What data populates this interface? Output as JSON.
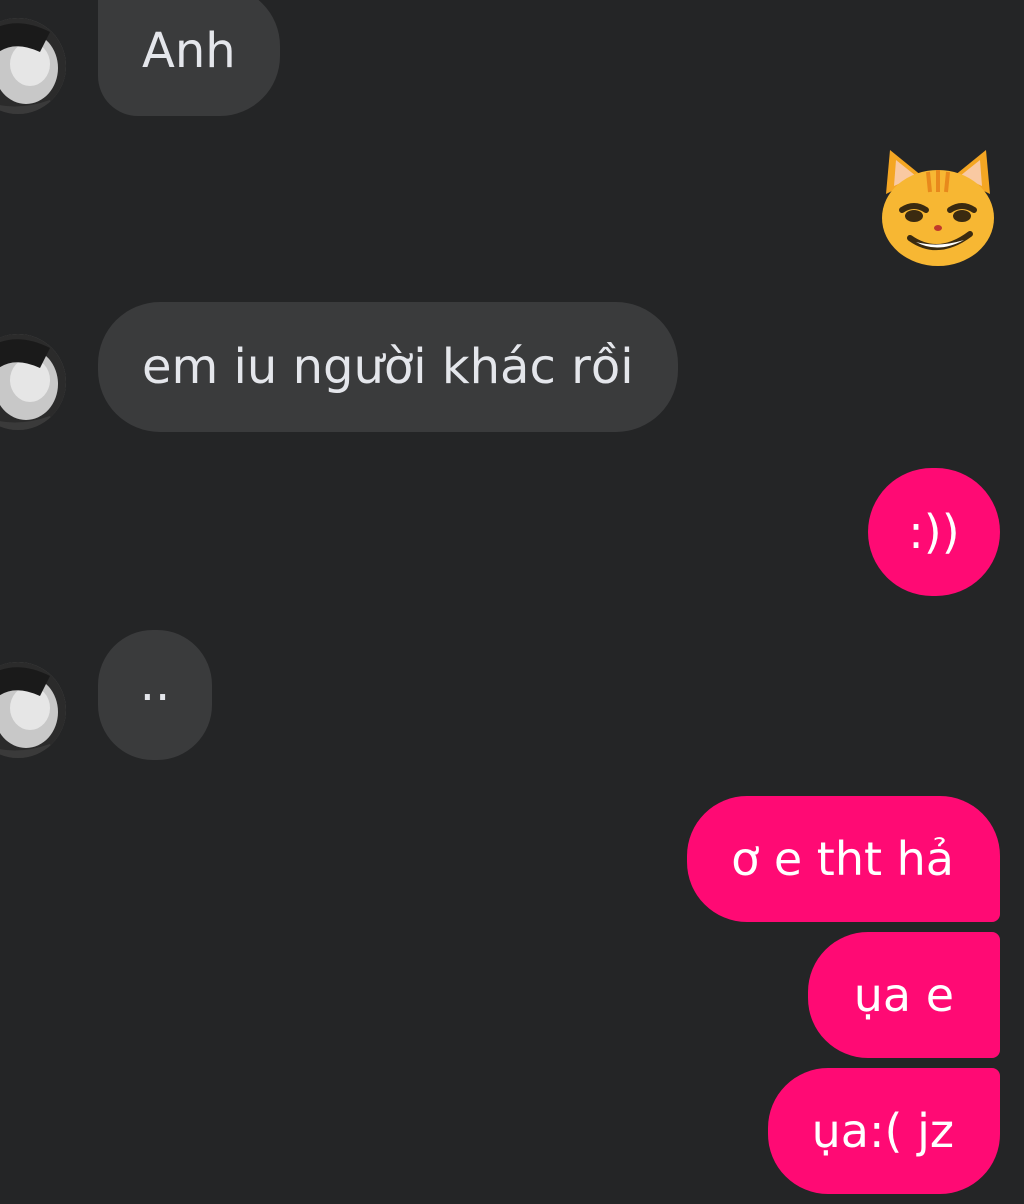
{
  "colors": {
    "background": "#242526",
    "incoming_bubble": "#3a3b3c",
    "incoming_text": "#e4e6eb",
    "outgoing_bubble": "#ff0a74",
    "outgoing_text": "#ffffff"
  },
  "messages": [
    {
      "sender": "other",
      "text": "Anh"
    },
    {
      "sender": "me",
      "emoji": "smirking-cat-emoji"
    },
    {
      "sender": "other",
      "text": "em iu người khác rồi"
    },
    {
      "sender": "me",
      "text": ":))"
    },
    {
      "sender": "other",
      "text": ".."
    },
    {
      "sender": "me",
      "text": "ơ e tht hả"
    },
    {
      "sender": "me",
      "text": "ụa e"
    },
    {
      "sender": "me",
      "text": "ụa:( jz"
    }
  ]
}
